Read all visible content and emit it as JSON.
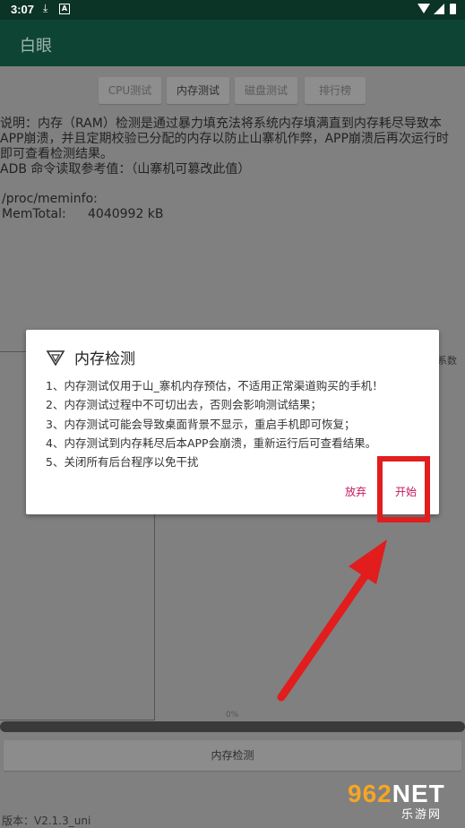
{
  "status_bar": {
    "time": "3:07",
    "download_icon": "download-icon",
    "notif_icon": "A"
  },
  "app_bar": {
    "title": "白眼"
  },
  "tabs": [
    {
      "label": "CPU测试",
      "active": false
    },
    {
      "label": "内存测试",
      "active": true
    },
    {
      "label": "磁盘测试",
      "active": false
    },
    {
      "label": "排行榜",
      "active": false
    }
  ],
  "description": "说明：内存（RAM）检测是通过暴力填充法将系统内存填满直到内存耗尽导致本\nAPP崩溃，并且定期校验已分配的内存以防止山寨机作弊，APP崩溃后再次运行时\n即可查看检测结果。\nADB 命令读取参考值：（山寨机可篡改此值）",
  "meminfo": {
    "path": "/proc/meminfo:",
    "label": "MemTotal:",
    "value": "4040992 kB"
  },
  "side_label": "系数",
  "progress": {
    "percent_label": "0%",
    "value": 0
  },
  "main_button": "内存检测",
  "version": "版本：V2.1.3_uni",
  "watermark": {
    "brand": "962",
    "net": "NET",
    "sub": "乐游网"
  },
  "dialog": {
    "title": "内存检测",
    "lines": [
      "1、内存测试仅用于山_寨机内存预估，不适用正常渠道购买的手机！",
      "2、内存测试过程中不可切出去，否则会影响测试结果；",
      "3、内存测试可能会导致桌面背景不显示，重启手机即可恢复；",
      "4、内存测试到内存耗尽后本APP会崩溃，重新运行后可查看结果。",
      "5、关闭所有后台程序以免干扰"
    ],
    "cancel_label": "放弃",
    "start_label": "开始"
  },
  "annotation_colors": {
    "highlight": "#e11d1d",
    "accent": "#c2185b",
    "appbar": "#0e4433"
  }
}
